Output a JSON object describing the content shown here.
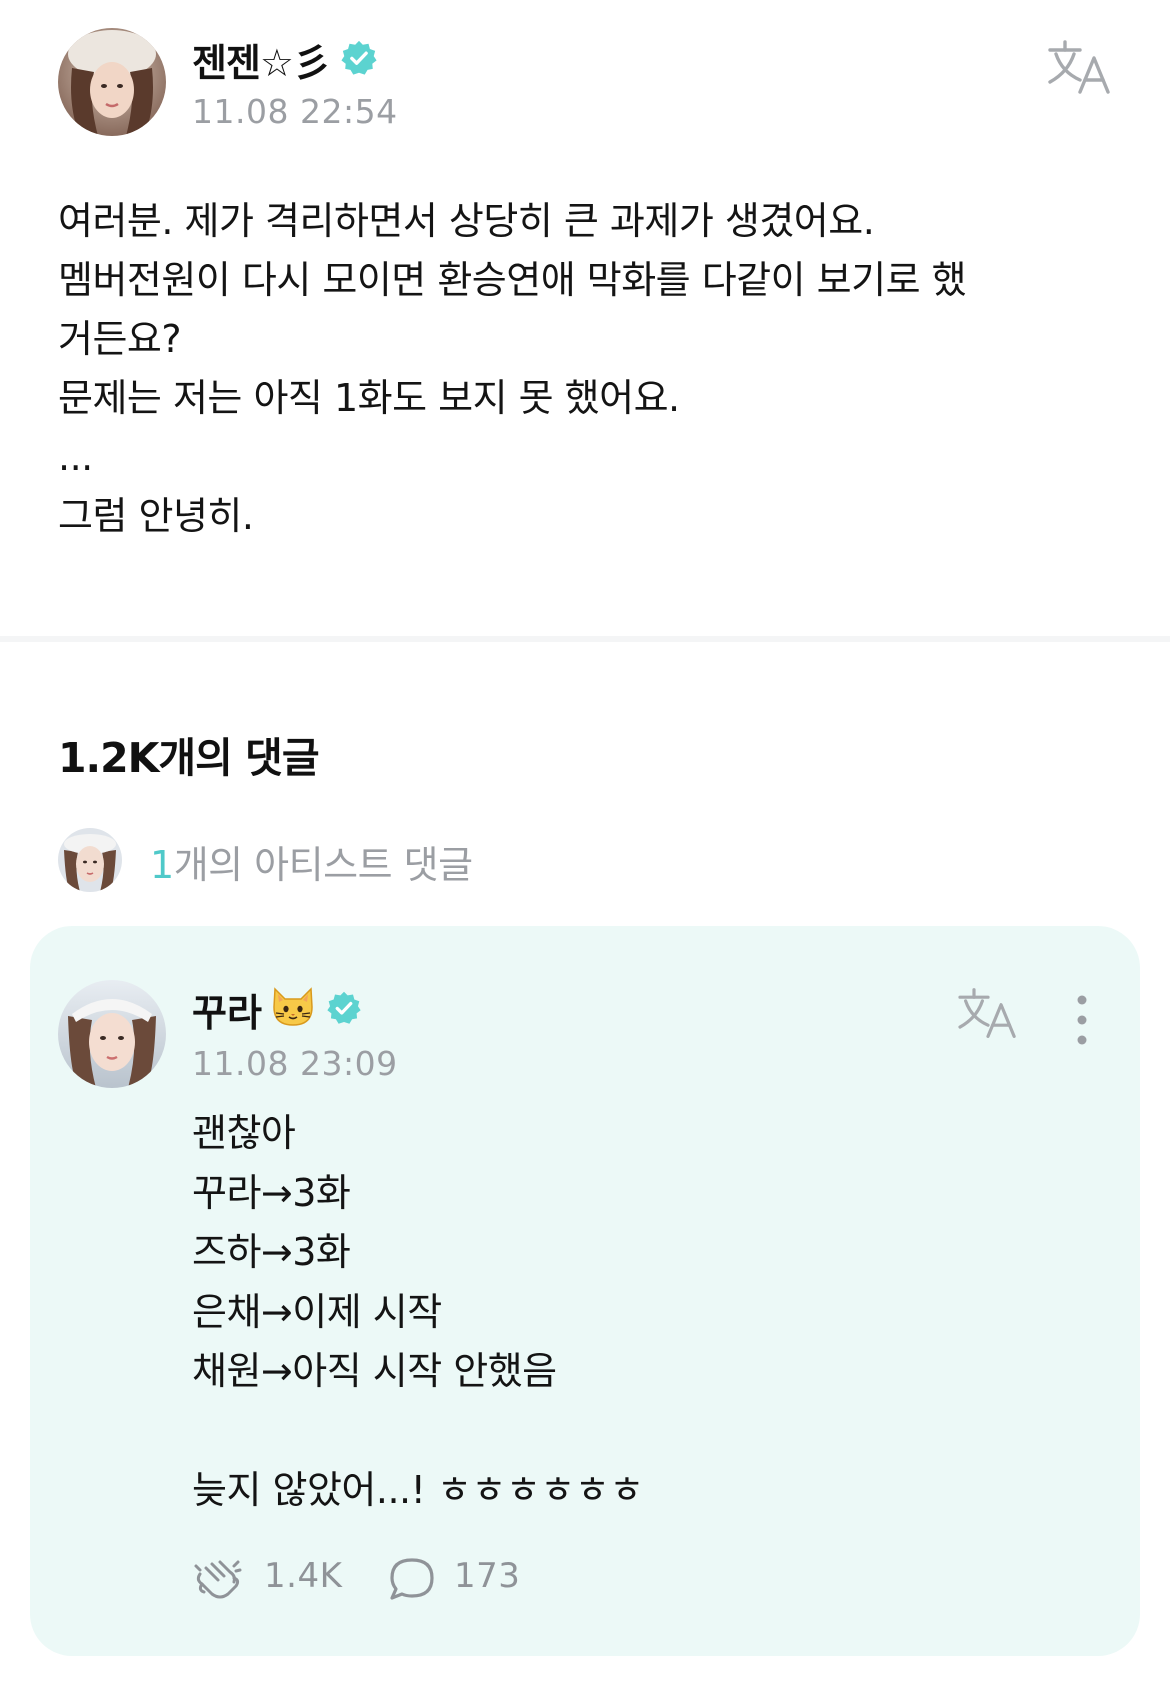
{
  "post": {
    "author": {
      "name": "젠젠☆彡",
      "verified": true,
      "avatar_icon": "avatar-photo-icon"
    },
    "timestamp": "11.08 22:54",
    "translate_icon": "translate-icon",
    "body": "여러분. 제가 격리하면서 상당히 큰 과제가 생겼어요.\n멤버전원이 다시 모이면 환승연애 막화를 다같이 보기로 했\n거든요?\n문제는 저는 아직 1화도 보지 못 했어요.\n...\n그럼 안녕히."
  },
  "comments": {
    "title": "1.2K개의 댓글",
    "artist_comments": {
      "count": "1",
      "label": "개의 아티스트 댓글"
    },
    "items": [
      {
        "author": "꾸라",
        "author_emoji_icon": "cat-face-icon",
        "verified": true,
        "timestamp": "11.08 23:09",
        "body": "괜찮아\n꾸라→3화\n즈하→3화\n은채→이제 시작\n채원→아직 시작 안했음\n\n늦지 않았어...! ㅎㅎㅎㅎㅎㅎ",
        "likes": "1.4K",
        "replies": "173"
      }
    ]
  },
  "colors": {
    "accent": "#4fc9c9",
    "verified_badge": "#5cd3d0",
    "muted_text": "#9b9ea3",
    "card_background": "#ecf9f7",
    "divider": "#f4f5f6"
  }
}
